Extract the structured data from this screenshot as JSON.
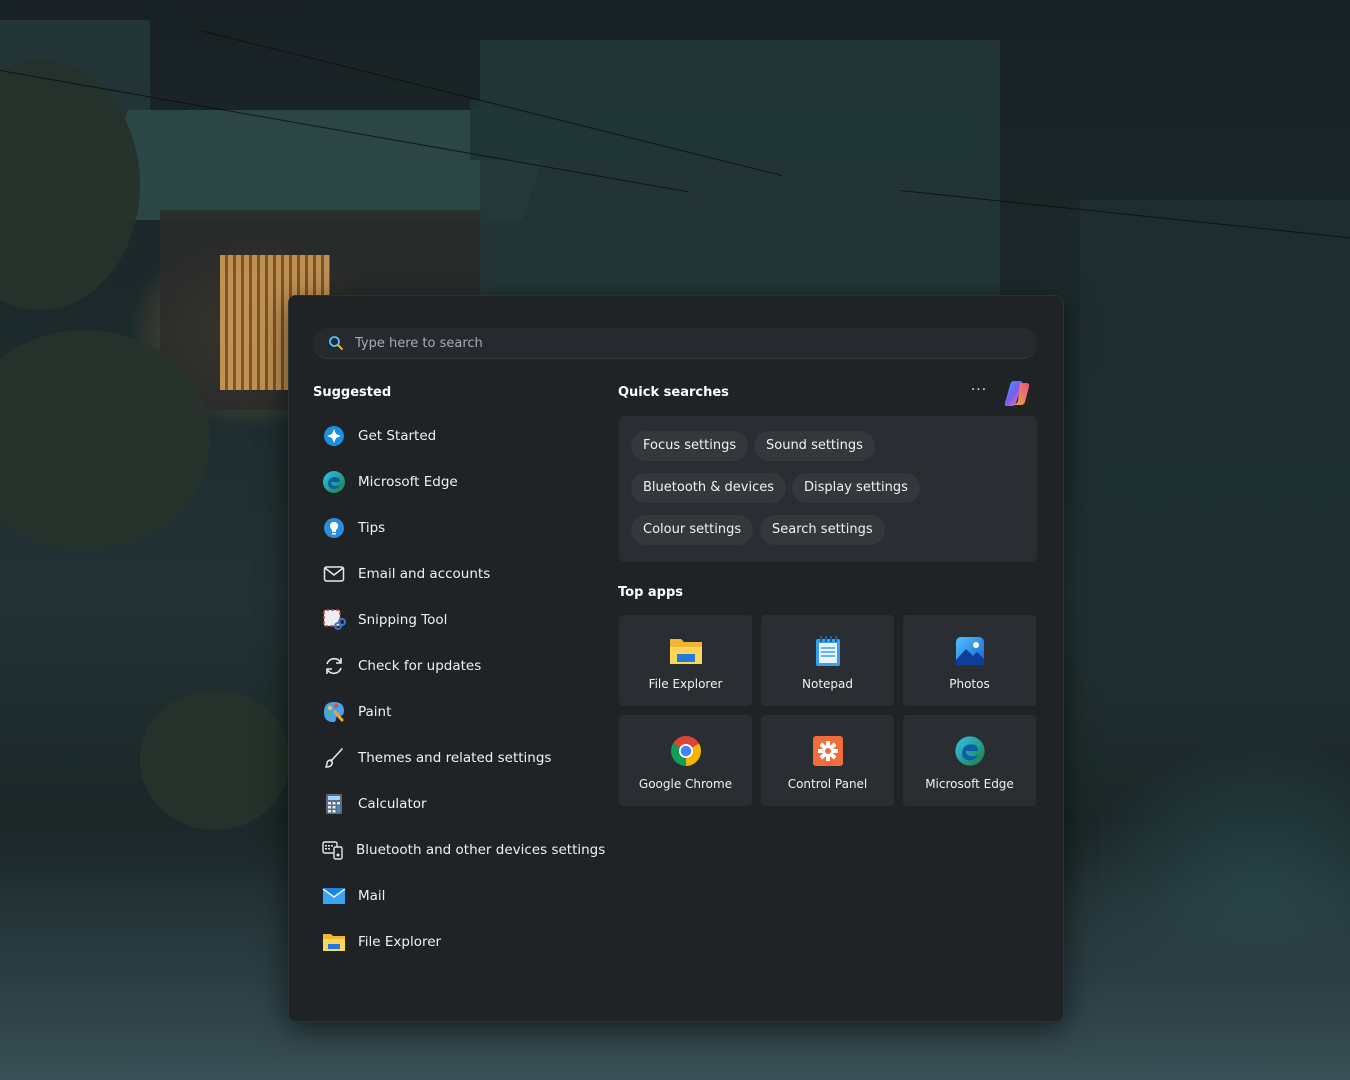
{
  "search": {
    "placeholder": "Type here to search"
  },
  "suggested": {
    "title": "Suggested",
    "items": [
      {
        "label": "Get Started",
        "icon": "get-started-icon"
      },
      {
        "label": "Microsoft Edge",
        "icon": "edge-icon"
      },
      {
        "label": "Tips",
        "icon": "tips-icon"
      },
      {
        "label": "Email and accounts",
        "icon": "mail-outline-icon"
      },
      {
        "label": "Snipping Tool",
        "icon": "snipping-tool-icon"
      },
      {
        "label": "Check for updates",
        "icon": "refresh-icon"
      },
      {
        "label": "Paint",
        "icon": "paint-icon"
      },
      {
        "label": "Themes and related settings",
        "icon": "brush-icon"
      },
      {
        "label": "Calculator",
        "icon": "calculator-icon"
      },
      {
        "label": "Bluetooth and other devices settings",
        "icon": "devices-icon"
      },
      {
        "label": "Mail",
        "icon": "mail-app-icon"
      },
      {
        "label": "File Explorer",
        "icon": "folder-icon"
      }
    ]
  },
  "quick_searches": {
    "title": "Quick searches",
    "more_label": "···",
    "chips": [
      "Focus settings",
      "Sound settings",
      "Bluetooth & devices",
      "Display settings",
      "Colour settings",
      "Search settings"
    ]
  },
  "top_apps": {
    "title": "Top apps",
    "apps": [
      {
        "label": "File Explorer",
        "icon": "folder-icon"
      },
      {
        "label": "Notepad",
        "icon": "notepad-icon"
      },
      {
        "label": "Photos",
        "icon": "photos-icon"
      },
      {
        "label": "Google Chrome",
        "icon": "chrome-icon"
      },
      {
        "label": "Control Panel",
        "icon": "control-panel-icon"
      },
      {
        "label": "Microsoft Edge",
        "icon": "edge-icon"
      }
    ]
  },
  "colors": {
    "panel": "#202326",
    "tile": "#2a2d31",
    "chip": "#34383c",
    "accent": "#4cc2ff"
  }
}
